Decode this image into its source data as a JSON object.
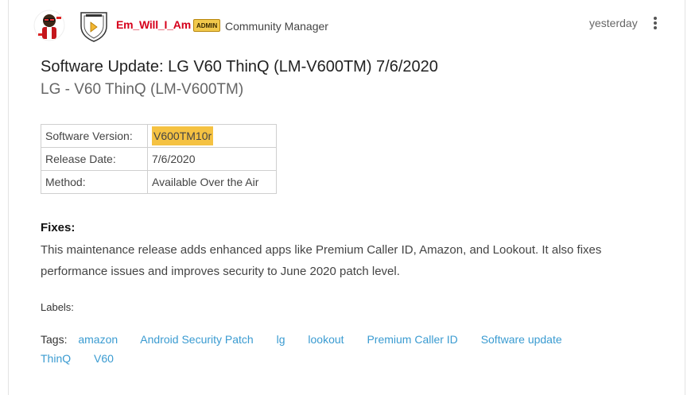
{
  "post": {
    "author": "Em_Will_I_Am",
    "admin_badge": "ADMIN",
    "role": "Community Manager",
    "timestamp": "yesterday",
    "title": "Software Update: LG V60 ThinQ (LM-V600TM) 7/6/2020",
    "subtitle": "LG -  V60 ThinQ (LM-V600TM)"
  },
  "specs": [
    {
      "label": "Software Version:",
      "value": "V600TM10r"
    },
    {
      "label": "Release Date:",
      "value": "7/6/2020"
    },
    {
      "label": "Method:",
      "value": "Available Over the Air"
    }
  ],
  "fixes": {
    "heading": "Fixes:",
    "body": "This maintenance release adds enhanced apps like Premium Caller ID, Amazon, and Lookout.  It also fixes performance issues and improves security to June 2020 patch level."
  },
  "labels": {
    "label": "Labels:"
  },
  "tags": {
    "label": "Tags:",
    "items": [
      "amazon",
      "Android Security Patch",
      "lg",
      "lookout",
      "Premium Caller ID",
      "Software update",
      "ThinQ",
      "V60"
    ]
  },
  "colors": {
    "author": "#d6001c",
    "highlight": "#f5c242",
    "tag_link": "#3a9bd1",
    "admin_badge": "#f2c94c"
  }
}
